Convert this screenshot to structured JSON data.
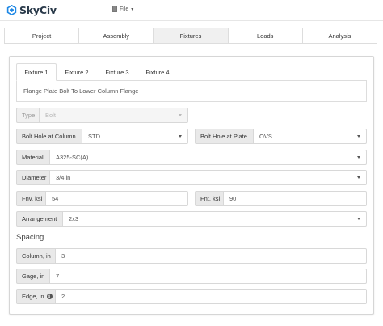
{
  "app": {
    "name": "SkyCiv",
    "file_menu": "File"
  },
  "main_tabs": [
    "Project",
    "Assembly",
    "Fixtures",
    "Loads",
    "Analysis"
  ],
  "active_main_tab": "Fixtures",
  "fixture_tabs": [
    "Fixture 1",
    "Fixture 2",
    "Fixture 3",
    "Fixture 4"
  ],
  "active_fixture_tab": "Fixture 1",
  "fixture": {
    "description": "Flange Plate Bolt To Lower Column Flange",
    "type": {
      "label": "Type",
      "value": "Bolt"
    },
    "bolt_hole_column": {
      "label": "Bolt Hole at Column",
      "value": "STD"
    },
    "bolt_hole_plate": {
      "label": "Bolt Hole at Plate",
      "value": "OVS"
    },
    "material": {
      "label": "Material",
      "value": "A325-SC(A)"
    },
    "diameter": {
      "label": "Diameter",
      "value": "3/4 in"
    },
    "fnv": {
      "label": "Fnv, ksi",
      "value": "54"
    },
    "fnt": {
      "label": "Fnt, ksi",
      "value": "90"
    },
    "arrangement": {
      "label": "Arrangement",
      "value": "2x3"
    }
  },
  "spacing": {
    "title": "Spacing",
    "column": {
      "label": "Column, in",
      "value": "3"
    },
    "gage": {
      "label": "Gage, in",
      "value": "7"
    },
    "edge": {
      "label": "Edge, in",
      "value": "2",
      "info_icon": "info-icon"
    }
  },
  "colors": {
    "brand_blue": "#1e88e5",
    "label_bg": "#e9e9e9",
    "border": "#d8d8d8"
  }
}
